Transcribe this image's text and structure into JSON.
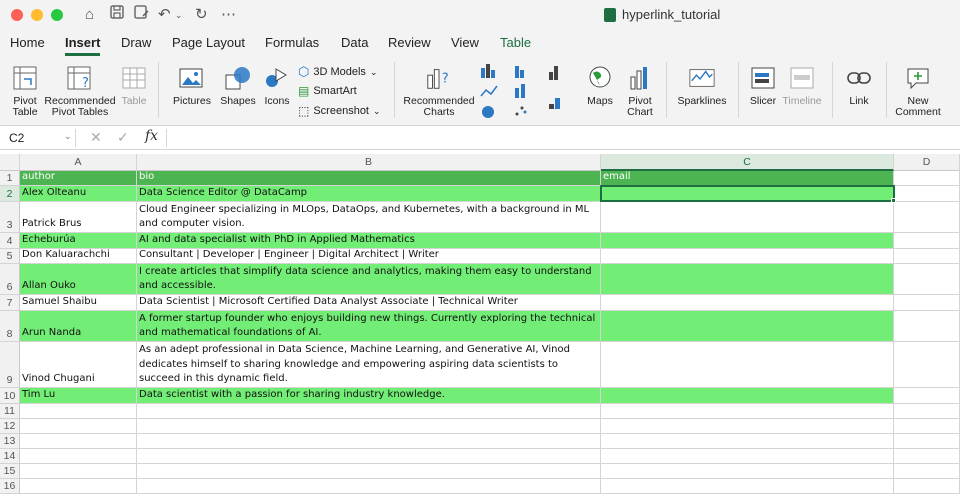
{
  "window": {
    "title": "hyperlink_tutorial"
  },
  "tabs": [
    {
      "label": "Home"
    },
    {
      "label": "Insert"
    },
    {
      "label": "Draw"
    },
    {
      "label": "Page Layout"
    },
    {
      "label": "Formulas"
    },
    {
      "label": "Data"
    },
    {
      "label": "Review"
    },
    {
      "label": "View"
    },
    {
      "label": "Table"
    }
  ],
  "ribbon": {
    "pivot_table": "Pivot Table",
    "recommended_pivot": "Recommended Pivot Tables",
    "table": "Table",
    "pictures": "Pictures",
    "shapes": "Shapes",
    "icons": "Icons",
    "models_3d": "3D Models",
    "smartart": "SmartArt",
    "screenshot": "Screenshot",
    "recommended_charts": "Recommended Charts",
    "maps": "Maps",
    "pivot_chart": "Pivot Chart",
    "sparklines": "Sparklines",
    "slicer": "Slicer",
    "timeline": "Timeline",
    "link": "Link",
    "new_comment": "New Comment"
  },
  "formula_bar": {
    "name_box": "C2",
    "fx": "fx",
    "content": ""
  },
  "columns": [
    "A",
    "B",
    "C",
    "D"
  ],
  "rows": [
    {
      "num": "1",
      "a": "author",
      "b": "bio",
      "c": "email"
    },
    {
      "num": "2",
      "a": "Alex Olteanu",
      "b": "Data Science Editor @ DataCamp",
      "c": ""
    },
    {
      "num": "3",
      "a": "Patrick Brus",
      "b": "Cloud Engineer specializing in MLOps, DataOps, and Kubernetes, with a background in ML and computer vision.",
      "c": ""
    },
    {
      "num": "4",
      "a": "Dr Ana Rojo-Echeburúa",
      "b": "AI and data specialist with PhD in Applied Mathematics",
      "c": ""
    },
    {
      "num": "5",
      "a": "Don Kaluarachchi",
      "b": "Consultant | Developer | Engineer | Digital Architect | Writer",
      "c": ""
    },
    {
      "num": "6",
      "a": "Allan Ouko",
      "b": "I create articles that simplify data science and analytics, making them easy to understand and accessible.",
      "c": ""
    },
    {
      "num": "7",
      "a": "Samuel Shaibu",
      "b": "Data Scientist | Microsoft Certified Data Analyst Associate | Technical Writer",
      "c": ""
    },
    {
      "num": "8",
      "a": "Arun Nanda",
      "b": "A former startup founder who enjoys building new things. Currently exploring the technical and mathematical foundations of AI.",
      "c": ""
    },
    {
      "num": "9",
      "a": "Vinod Chugani",
      "b": "As an adept professional in Data Science, Machine Learning, and Generative AI, Vinod dedicates himself to sharing knowledge and empowering aspiring data scientists to succeed in this dynamic field.",
      "c": ""
    },
    {
      "num": "10",
      "a": "Tim Lu",
      "b": "Data scientist with a passion for sharing industry knowledge.",
      "c": ""
    },
    {
      "num": "11",
      "a": "",
      "b": "",
      "c": ""
    },
    {
      "num": "12",
      "a": "",
      "b": "",
      "c": ""
    },
    {
      "num": "13",
      "a": "",
      "b": "",
      "c": ""
    },
    {
      "num": "14",
      "a": "",
      "b": "",
      "c": ""
    },
    {
      "num": "15",
      "a": "",
      "b": "",
      "c": ""
    },
    {
      "num": "16",
      "a": "",
      "b": "",
      "c": ""
    }
  ],
  "colors": {
    "header_green": "#4cb552",
    "row_green": "#72ed75",
    "accent": "#1d6f42"
  }
}
